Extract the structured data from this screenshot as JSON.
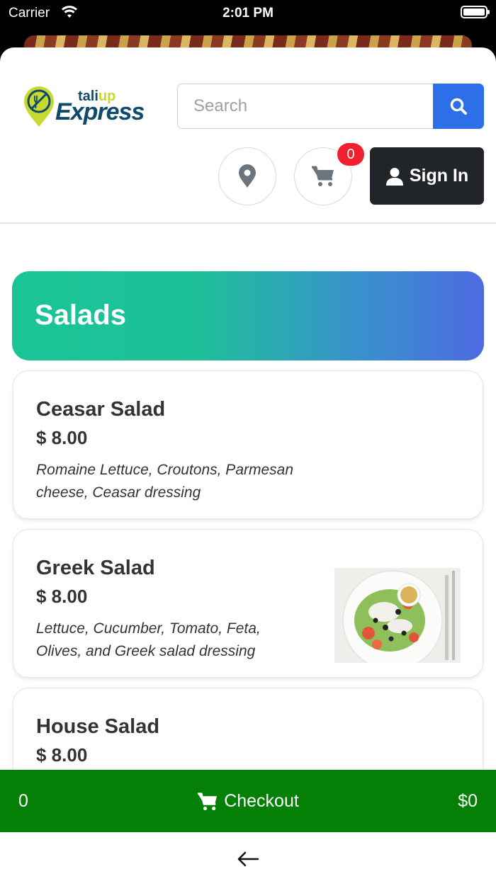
{
  "status_bar": {
    "carrier": "Carrier",
    "time": "2:01 PM"
  },
  "header": {
    "brand_top_1": "tali",
    "brand_top_2": "up",
    "brand_main": "Express",
    "search_placeholder": "Search",
    "cart_count": "0",
    "signin_label": "Sign In"
  },
  "category": {
    "title": "Salads"
  },
  "items": [
    {
      "name": "Ceasar Salad",
      "price": "$ 8.00",
      "description": "Romaine Lettuce, Croutons, Parmesan cheese, Ceasar dressing",
      "has_photo": false
    },
    {
      "name": "Greek Salad",
      "price": "$ 8.00",
      "description": "Lettuce, Cucumber, Tomato, Feta, Olives, and Greek salad dressing",
      "has_photo": true
    },
    {
      "name": "House Salad",
      "price": "$ 8.00",
      "description": "",
      "has_photo": false
    }
  ],
  "checkout": {
    "item_count": "0",
    "label": "Checkout",
    "total": "$0"
  },
  "colors": {
    "accent_blue": "#2c6fe8",
    "checkout_green": "#058006",
    "badge_red": "#f21f2f",
    "category_gradient_start": "#19c596",
    "category_gradient_end": "#4e6ae0"
  }
}
